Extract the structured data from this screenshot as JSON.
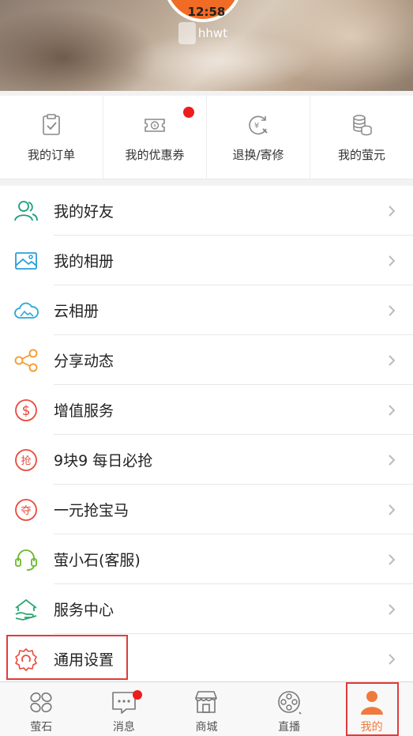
{
  "status_bar": {
    "time": "12:58"
  },
  "profile": {
    "username": "hhwt"
  },
  "quick_actions": [
    {
      "label": "我的订单",
      "icon": "clipboard-check-icon",
      "badge": false
    },
    {
      "label": "我的优惠券",
      "icon": "coupon-icon",
      "badge": true
    },
    {
      "label": "退换/寄修",
      "icon": "return-repair-icon",
      "badge": false
    },
    {
      "label": "我的萤元",
      "icon": "coin-stack-icon",
      "badge": false
    }
  ],
  "menu": [
    {
      "label": "我的好友",
      "icon": "friends-icon",
      "color": "#1a9e7a"
    },
    {
      "label": "我的相册",
      "icon": "photo-album-icon",
      "color": "#2a9fd8"
    },
    {
      "label": "云相册",
      "icon": "cloud-album-icon",
      "color": "#2aa8d8"
    },
    {
      "label": "分享动态",
      "icon": "share-icon",
      "color": "#f29b2a"
    },
    {
      "label": "增值服务",
      "icon": "dollar-icon",
      "color": "#e84a3c"
    },
    {
      "label": "9块9 每日必抢",
      "icon": "grab-icon",
      "color": "#e84a3c"
    },
    {
      "label": "一元抢宝马",
      "icon": "snatch-icon",
      "color": "#e84a3c"
    },
    {
      "label": "萤小石(客服)",
      "icon": "headset-icon",
      "color": "#6ab82d"
    },
    {
      "label": "服务中心",
      "icon": "service-center-icon",
      "color": "#2aa86e"
    },
    {
      "label": "通用设置",
      "icon": "gear-icon",
      "color": "#e84a3c"
    }
  ],
  "tabs": [
    {
      "label": "萤石",
      "icon": "ezviz-icon",
      "active": false,
      "badge": false
    },
    {
      "label": "消息",
      "icon": "message-icon",
      "active": false,
      "badge": true
    },
    {
      "label": "商城",
      "icon": "store-icon",
      "active": false,
      "badge": false
    },
    {
      "label": "直播",
      "icon": "live-icon",
      "active": false,
      "badge": false
    },
    {
      "label": "我的",
      "icon": "person-icon",
      "active": true,
      "badge": false
    }
  ],
  "colors": {
    "accent": "#f07a3d",
    "highlight_box": "#e23b3b",
    "badge": "#ee1c1c"
  }
}
